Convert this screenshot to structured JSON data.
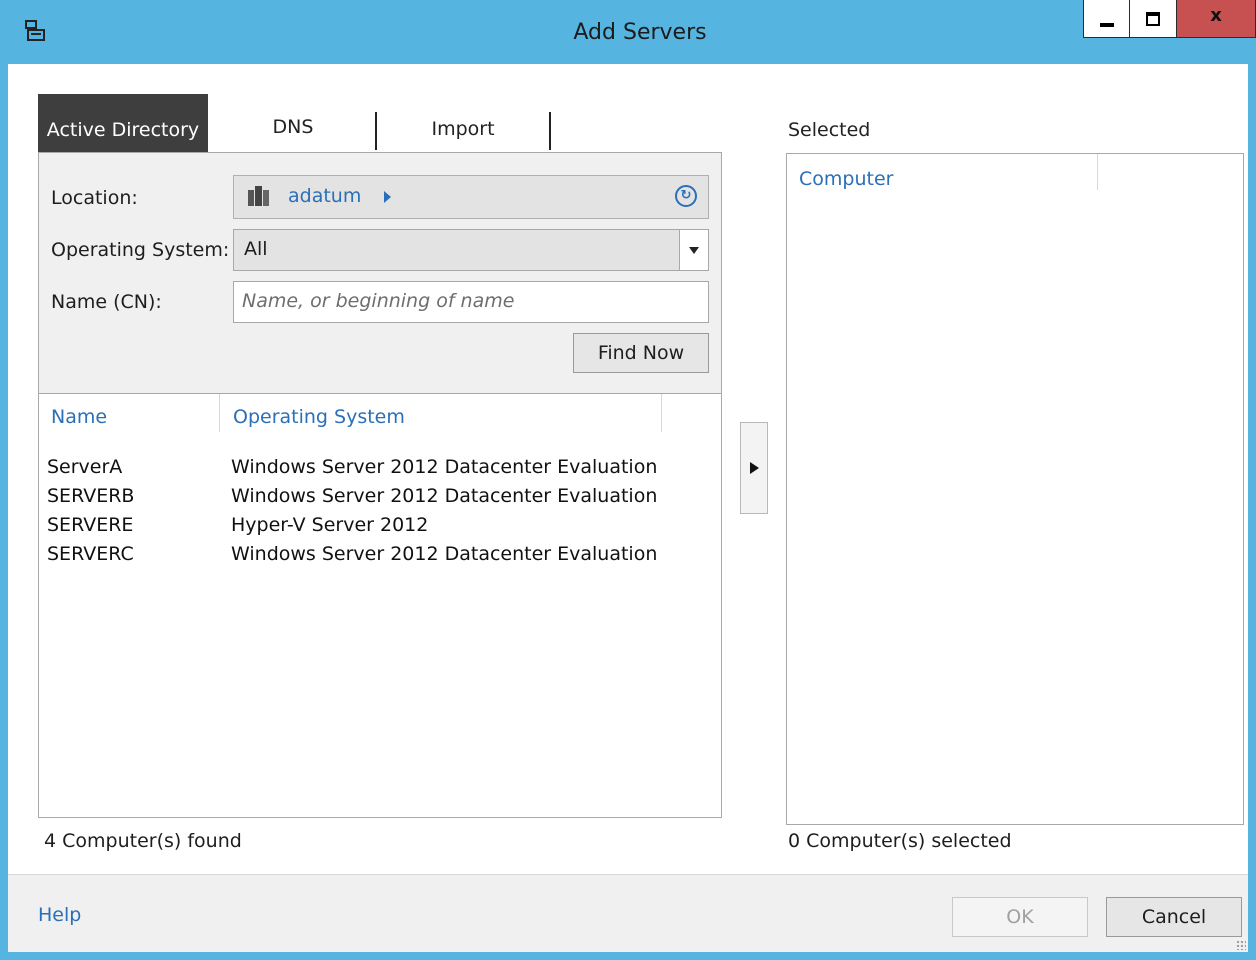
{
  "window": {
    "title": "Add Servers",
    "controls": {
      "minimize": "minimize",
      "maximize": "maximize",
      "close": "x"
    }
  },
  "tabs": [
    {
      "label": "Active Directory",
      "active": true
    },
    {
      "label": "DNS",
      "active": false
    },
    {
      "label": "Import",
      "active": false
    }
  ],
  "criteria": {
    "location_label": "Location:",
    "location_value": "adatum",
    "os_label": "Operating System:",
    "os_value": "All",
    "name_label": "Name (CN):",
    "name_placeholder": "Name, or beginning of name",
    "name_value": "",
    "find_now": "Find Now"
  },
  "results": {
    "columns": [
      "Name",
      "Operating System"
    ],
    "rows": [
      {
        "name": "ServerA",
        "os": "Windows Server 2012 Datacenter Evaluation"
      },
      {
        "name": "SERVERB",
        "os": "Windows Server 2012 Datacenter Evaluation"
      },
      {
        "name": "SERVERE",
        "os": "Hyper-V Server 2012"
      },
      {
        "name": "SERVERC",
        "os": "Windows Server 2012 Datacenter Evaluation"
      }
    ],
    "status": "4 Computer(s) found"
  },
  "selected": {
    "label": "Selected",
    "column": "Computer",
    "status": "0 Computer(s) selected"
  },
  "footer": {
    "help": "Help",
    "ok": "OK",
    "cancel": "Cancel"
  },
  "colors": {
    "accent": "#56b5e0",
    "link": "#2a6fb8",
    "close_button": "#c75050",
    "active_tab": "#3e3e3e"
  }
}
